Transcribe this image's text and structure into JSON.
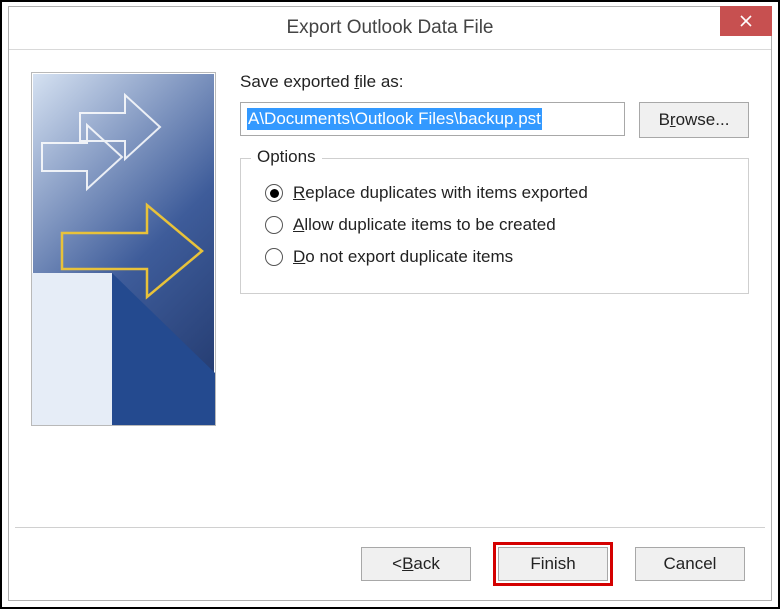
{
  "titlebar": {
    "title": "Export Outlook Data File"
  },
  "body": {
    "save_label_pre": "Save exported ",
    "save_label_mn": "f",
    "save_label_post": "ile as:",
    "path_value": "A\\Documents\\Outlook Files\\backup.pst",
    "browse_mn": "r",
    "browse_pre": "B",
    "browse_post": "owse...",
    "options_title": "Options",
    "radios": [
      {
        "mn": "R",
        "pre": "",
        "post": "eplace duplicates with items exported",
        "selected": true
      },
      {
        "mn": "A",
        "pre": "",
        "post": "llow duplicate items to be created",
        "selected": false
      },
      {
        "mn": "D",
        "pre": "",
        "post": "o not export duplicate items",
        "selected": false
      }
    ]
  },
  "footer": {
    "back_prefix": "<  ",
    "back_mn": "B",
    "back_post": "ack",
    "finish": "Finish",
    "cancel": "Cancel"
  }
}
